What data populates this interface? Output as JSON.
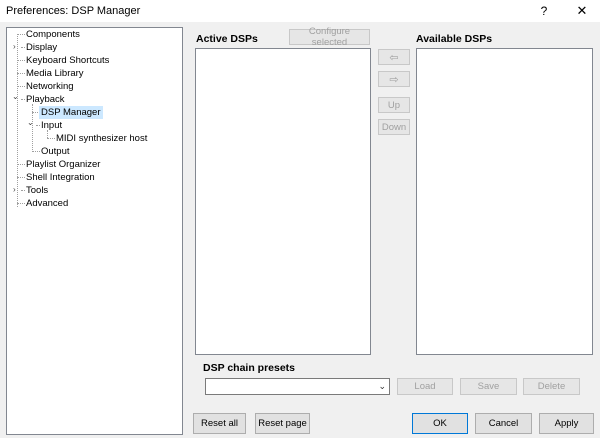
{
  "window": {
    "title": "Preferences: DSP Manager",
    "help_glyph": "?",
    "close_glyph": "✕"
  },
  "tree": {
    "items": [
      {
        "label": "Components"
      },
      {
        "label": "Display"
      },
      {
        "label": "Keyboard Shortcuts"
      },
      {
        "label": "Media Library"
      },
      {
        "label": "Networking"
      },
      {
        "label": "Playback"
      },
      {
        "label": "DSP Manager",
        "selected": true
      },
      {
        "label": "Input"
      },
      {
        "label": "MIDI synthesizer host"
      },
      {
        "label": "Output"
      },
      {
        "label": "Playlist Organizer"
      },
      {
        "label": "Shell Integration"
      },
      {
        "label": "Tools"
      },
      {
        "label": "Advanced"
      }
    ],
    "expander_collapsed": "›",
    "expander_expanded": "⌄"
  },
  "active": {
    "title": "Active DSPs",
    "configure_label": "Configure selected"
  },
  "available": {
    "title": "Available DSPs"
  },
  "move": {
    "left_glyph": "⇦",
    "right_glyph": "⇨",
    "up_label": "Up",
    "down_label": "Down"
  },
  "presets": {
    "title": "DSP chain presets",
    "value": "",
    "load_label": "Load",
    "save_label": "Save",
    "delete_label": "Delete"
  },
  "footer": {
    "reset_all_label": "Reset all",
    "reset_page_label": "Reset page",
    "ok_label": "OK",
    "cancel_label": "Cancel",
    "apply_label": "Apply"
  }
}
